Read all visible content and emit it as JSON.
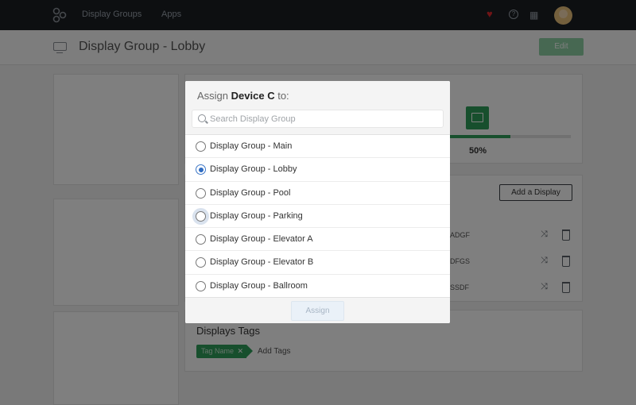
{
  "topbar": {
    "logo_icon": "app-logo",
    "nav": [
      "Display Groups",
      "Apps"
    ],
    "icons": [
      "heart-icon",
      "help-icon",
      "grid-icon"
    ],
    "accent_heart": "#e0282d"
  },
  "header": {
    "icon": "monitor-icon",
    "title": "Display Group - Lobby",
    "edit_label": "Edit"
  },
  "upload": {
    "progress_percent": 50,
    "progress_label": "50%",
    "accent": "#2e9e5b"
  },
  "displays": {
    "add_label": "Add a Display",
    "rows": [
      {
        "code": "ADGF"
      },
      {
        "code": "DFGS"
      },
      {
        "code": "SSDF"
      }
    ]
  },
  "tags": {
    "title": "Displays Tags",
    "items": [
      "Tag Name"
    ],
    "add_label": "Add Tags"
  },
  "modal": {
    "title_prefix": "Assign",
    "device_name": "Device C",
    "title_suffix": "to:",
    "search_placeholder": "Search Display Group",
    "options": [
      {
        "label": "Display Group - Main",
        "checked": false
      },
      {
        "label": "Display Group - Lobby",
        "checked": true
      },
      {
        "label": "Display Group - Pool",
        "checked": false
      },
      {
        "label": "Display Group - Parking",
        "checked": false
      },
      {
        "label": "Display Group - Elevator A",
        "checked": false
      },
      {
        "label": "Display Group - Elevator B",
        "checked": false
      },
      {
        "label": "Display Group - Ballroom",
        "checked": false
      }
    ],
    "assign_label": "Assign",
    "accent": "#2f6cc2"
  }
}
